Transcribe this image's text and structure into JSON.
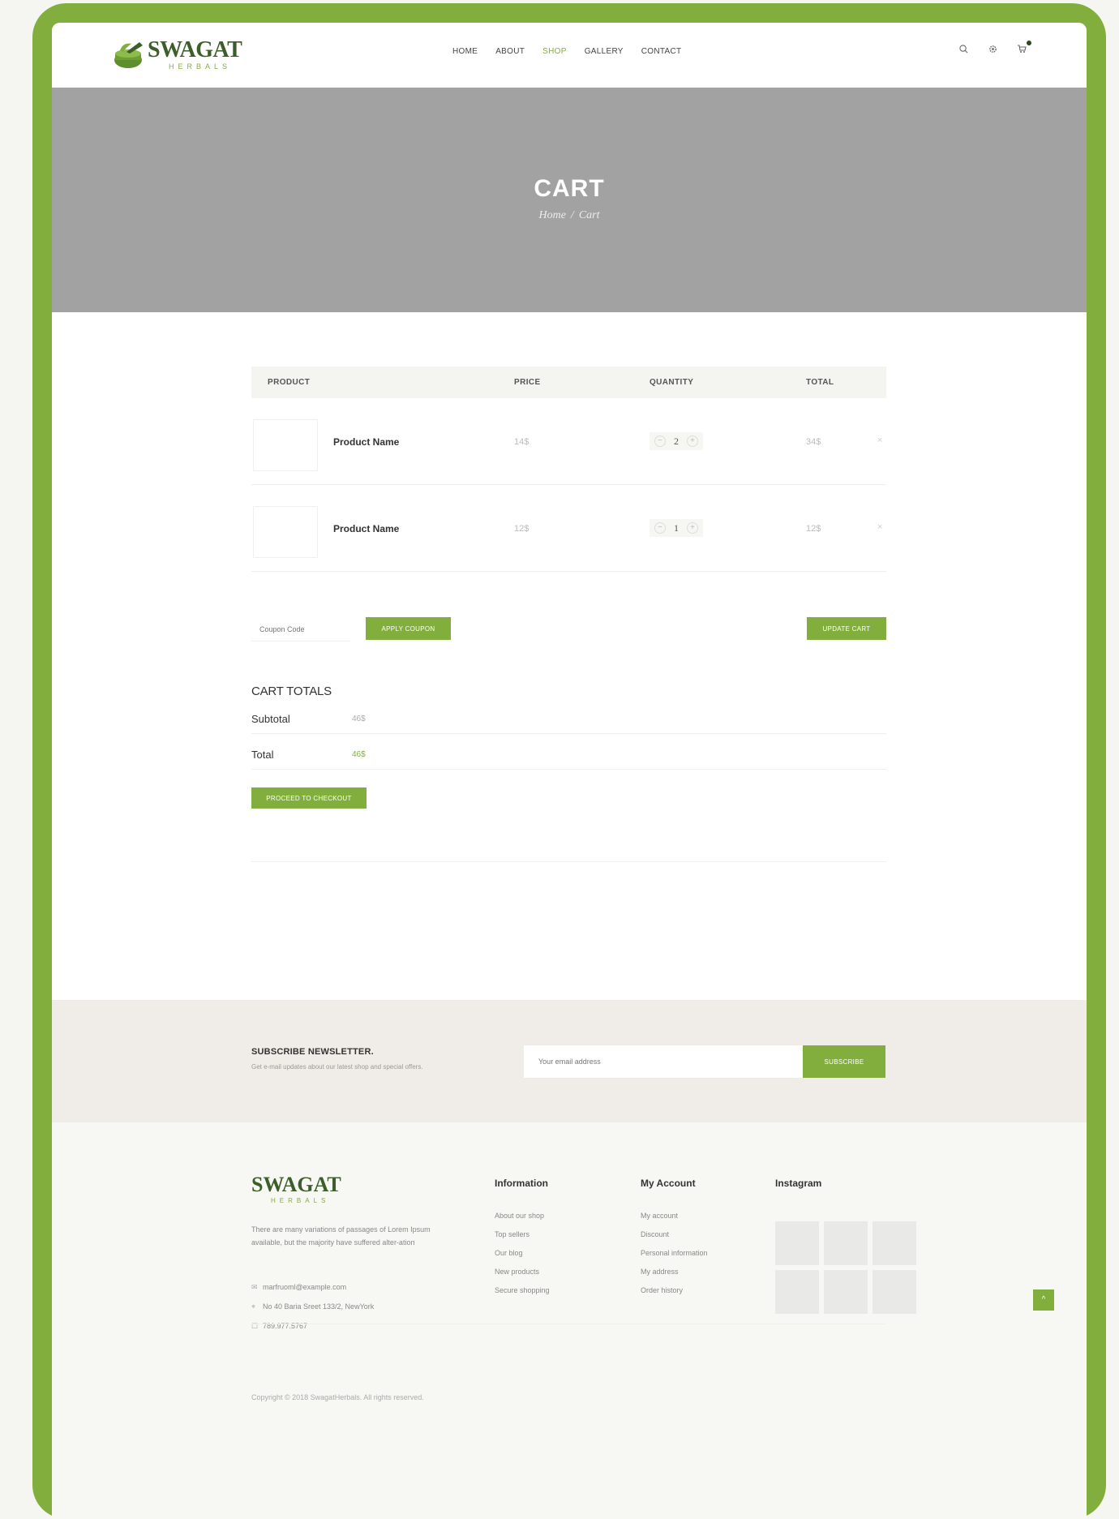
{
  "header": {
    "logo_text": "SWAGAT",
    "logo_sub": "HERBALS",
    "nav": [
      {
        "label": "HOME",
        "active": false
      },
      {
        "label": "ABOUT",
        "active": false
      },
      {
        "label": "SHOP",
        "active": true
      },
      {
        "label": "GALLERY",
        "active": false
      },
      {
        "label": "CONTACT",
        "active": false
      }
    ],
    "icons": [
      "search-icon",
      "settings-icon",
      "cart-icon"
    ]
  },
  "banner": {
    "title": "CART",
    "breadcrumb": [
      "Home",
      "Cart"
    ],
    "separator": "/"
  },
  "cart": {
    "columns": [
      "PRODUCT",
      "PRICE",
      "QUANTITY",
      "TOTAL"
    ],
    "rows": [
      {
        "name": "Product Name",
        "price": "14$",
        "qty": "2",
        "total": "34$"
      },
      {
        "name": "Product Name",
        "price": "12$",
        "qty": "1",
        "total": "12$"
      }
    ],
    "minus": "−",
    "plus": "+",
    "remove": "×",
    "coupon_placeholder": "Coupon Code",
    "apply_label": "APPLY COUPON",
    "update_label": "UPDATE CART"
  },
  "totals": {
    "title": "CART TOTALS",
    "subtotal_label": "Subtotal",
    "subtotal_value": "46$",
    "total_label": "Total",
    "total_value": "46$",
    "checkout_label": "PROCEED TO CHECKOUT"
  },
  "newsletter": {
    "title": "SUBSCRIBE NEWSLETTER.",
    "subtitle": "Get e-mail updates about our latest shop and special offers.",
    "placeholder": "Your email address",
    "button": "SUBSCRIBE"
  },
  "footer": {
    "logo_text": "SWAGAT",
    "logo_sub": "HERBALS",
    "description": "There are many variations of passages of Lorem Ipsum available, but the majority have suffered alter-ation",
    "email": "marfruoml@example.com",
    "address": "No 40 Baria Sreet 133/2, NewYork",
    "phone": "789.977.5767",
    "information": {
      "title": "Information",
      "links": [
        "About our shop",
        "Top sellers",
        "Our blog",
        "New products",
        "Secure shopping"
      ]
    },
    "account": {
      "title": "My Account",
      "links": [
        "My account",
        "Discount",
        "Personal information",
        "My address",
        "Order history"
      ]
    },
    "instagram": {
      "title": "Instagram"
    },
    "copyright": "Copyright © 2018 SwagatHerbals. All rights reserved.",
    "back_to_top": "^"
  },
  "colors": {
    "accent": "#82ae3e",
    "banner": "#a2a2a2",
    "brand_dark": "#3c5e2a"
  }
}
